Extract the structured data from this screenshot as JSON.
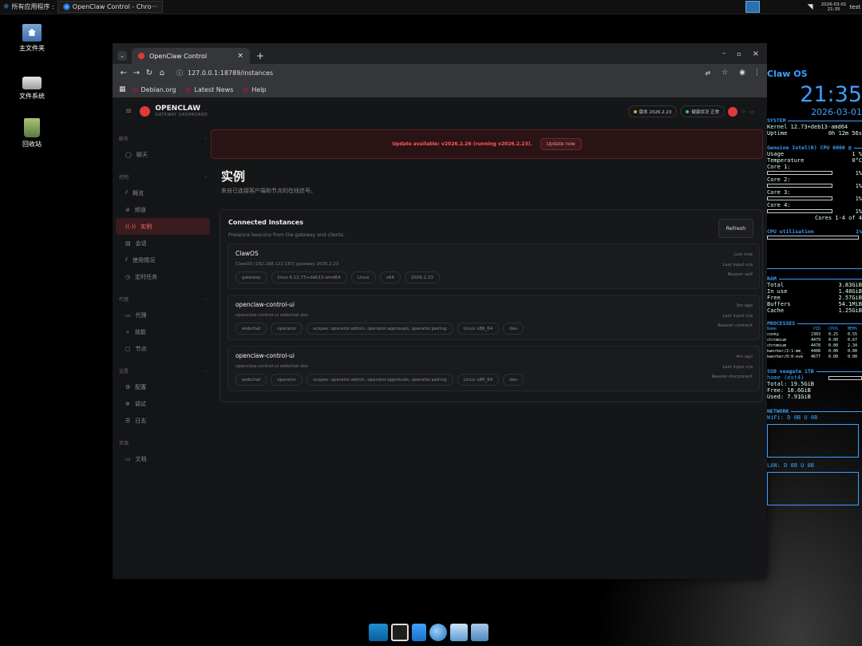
{
  "taskbar": {
    "apps_menu": "所有应用程序 :",
    "active_window": "OpenClaw Control - Chro···",
    "clock_date": "2026-03-01",
    "clock_time": "21:35",
    "user": "test"
  },
  "desktop_icons": [
    {
      "label": "主文件夹",
      "icon": "home-folder-icon"
    },
    {
      "label": "文件系统",
      "icon": "drive-icon"
    },
    {
      "label": "回收站",
      "icon": "trash-icon"
    }
  ],
  "browser": {
    "tab_title": "OpenClaw Control",
    "url": "127.0.0.1:18789/instances",
    "bookmarks": [
      "Debian.org",
      "Latest News",
      "Help"
    ]
  },
  "app": {
    "brand": "OPENCLAW",
    "brand_sub": "GATEWAY DASHBOARD",
    "version_badge": "版本 2026.2.23",
    "health_badge": "健康状况 正常",
    "update_banner": {
      "text": "Update available: v2026.2.26 (running v2026.2.23).",
      "button": "Update now"
    },
    "page_title": "实例",
    "page_subtitle": "来自已连接客户端和节点的在线信号。",
    "card": {
      "title": "Connected Instances",
      "subtitle": "Presence beacons from the gateway and clients.",
      "refresh": "Refresh"
    },
    "instances": [
      {
        "name": "ClawOS",
        "detail": "ClawOS (192.168.122.187) gateway 2026.2.23",
        "tags": [
          "gateway",
          "linux 6.12.73+deb13-amd64",
          "Linux",
          "x64",
          "2026.2.23"
        ],
        "time": "just now",
        "last_input": "Last input n/a",
        "reason": "Reason self"
      },
      {
        "name": "openclaw-control-ui",
        "detail": "openclaw-control-ui webchat dev",
        "tags": [
          "webchat",
          "operator",
          "scopes: operator.admin, operator.approvals, operator.pairing",
          "Linux x86_64",
          "dev"
        ],
        "time": "3m ago",
        "last_input": "Last input n/a",
        "reason": "Reason connect"
      },
      {
        "name": "openclaw-control-ui",
        "detail": "openclaw-control-ui webchat dev",
        "tags": [
          "webchat",
          "operator",
          "scopes: operator.admin, operator.approvals, operator.pairing",
          "Linux x86_64",
          "dev"
        ],
        "time": "4m ago",
        "last_input": "Last input n/a",
        "reason": "Reason disconnect"
      }
    ],
    "sidebar": [
      {
        "group": "聊天",
        "items": [
          {
            "label": "聊天",
            "icon": "chat-icon"
          }
        ]
      },
      {
        "group": "控制",
        "items": [
          {
            "label": "概览",
            "icon": "chart-icon"
          },
          {
            "label": "频道",
            "icon": "link-icon"
          },
          {
            "label": "实例",
            "icon": "broadcast-icon",
            "active": true
          },
          {
            "label": "会话",
            "icon": "document-icon"
          },
          {
            "label": "使用情况",
            "icon": "chart-icon"
          },
          {
            "label": "定时任务",
            "icon": "clock-icon"
          }
        ]
      },
      {
        "group": "代理",
        "items": [
          {
            "label": "代理",
            "icon": "folder-icon"
          },
          {
            "label": "技能",
            "icon": "sparkle-icon"
          },
          {
            "label": "节点",
            "icon": "monitor-icon"
          }
        ]
      },
      {
        "group": "设置",
        "items": [
          {
            "label": "配置",
            "icon": "gear-icon"
          },
          {
            "label": "调试",
            "icon": "bug-icon"
          },
          {
            "label": "日志",
            "icon": "log-icon"
          }
        ]
      },
      {
        "group": "资源",
        "items": [
          {
            "label": "文档",
            "icon": "book-icon"
          }
        ]
      }
    ]
  },
  "conky": {
    "title": "Claw OS",
    "time": "21:35",
    "date": "2026-03-01",
    "system_head": "SYSTEM",
    "kernel": "Kernel 12.73+deb13-amd64",
    "uptime_label": "Uptime",
    "uptime": "0h 12m 56s",
    "cpu_head": "Genuine Intel(R) CPU 0000 @",
    "usage_label": "Usage",
    "usage": "1 %",
    "temp_label": "Temperature",
    "temp": "0°C",
    "cores": [
      {
        "label": "Core 1:",
        "val": "1%"
      },
      {
        "label": "Core 2:",
        "val": "1%"
      },
      {
        "label": "Core 3:",
        "val": "1%"
      },
      {
        "label": "Core 4:",
        "val": "1%"
      }
    ],
    "cores_summary": "Cores 1-4 of 4",
    "cpu_util_label": "CPU utilisation",
    "cpu_util": "1%",
    "ram_head": "RAM",
    "ram": [
      {
        "k": "Total",
        "v": "3.83GiB"
      },
      {
        "k": "In use",
        "v": "1.48GiB"
      },
      {
        "k": "Free",
        "v": "2.57GiB"
      },
      {
        "k": "Buffers",
        "v": "54.1MiB"
      },
      {
        "k": "Cache",
        "v": "1.25GiB"
      }
    ],
    "proc_head": "PROCESSES",
    "proc_cols": [
      "Name",
      "PID",
      "CPU%",
      "MEM%"
    ],
    "procs": [
      [
        "conky",
        "2303",
        "0.25",
        "0.55"
      ],
      [
        "chromium",
        "4479",
        "0.00",
        "0.67"
      ],
      [
        "chromium",
        "4478",
        "0.00",
        "2.34"
      ],
      [
        "kworker/2:1-mm_p",
        "4408",
        "0.00",
        "0.00"
      ],
      [
        "kworker/0:0-events",
        "4677",
        "0.00",
        "0.00"
      ]
    ],
    "ssd_head": "SSD seagate 1TB",
    "ssd_home": "home (ext4)",
    "ssd": [
      {
        "k": "Total:",
        "v": "19.5GiB"
      },
      {
        "k": "Free:",
        "v": "10.6GiB"
      },
      {
        "k": "Used:",
        "v": "7.91GiB"
      }
    ],
    "net_head": "NETWORK",
    "wifi": "WiFi:  D 0B  U 0B",
    "lan": "LAN:  D 0B  U 0B"
  }
}
